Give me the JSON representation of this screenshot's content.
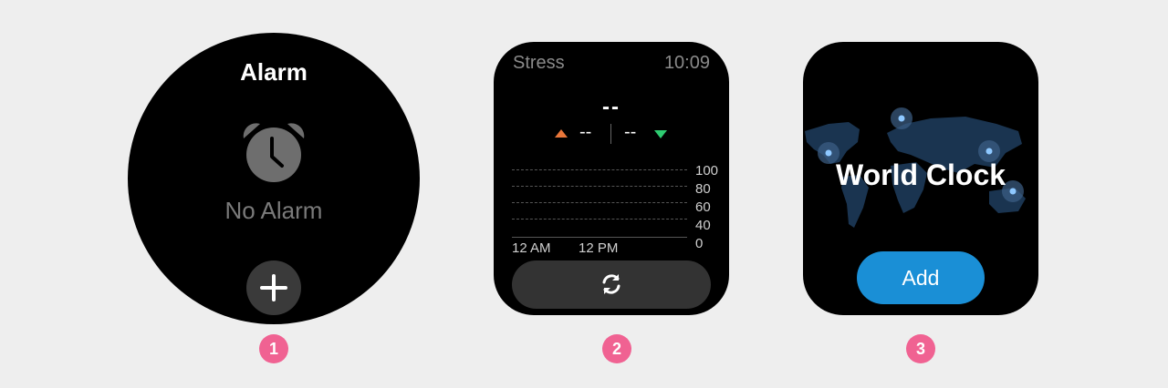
{
  "screens": [
    {
      "title": "Alarm",
      "icon": "alarm-clock-icon",
      "status": "No Alarm",
      "action_icon": "plus-icon"
    },
    {
      "title": "Stress",
      "time": "10:09",
      "value": "--",
      "low_value": "--",
      "high_value": "--",
      "low_indicator_color": "#e8763a",
      "high_indicator_color": "#2ecc71",
      "action_icon": "refresh-icon"
    },
    {
      "title": "World Clock",
      "background_icon": "world-map-icon",
      "button_label": "Add",
      "accent": "#1a8fd6"
    }
  ],
  "chart_data": {
    "type": "line",
    "yticks": [
      "100",
      "80",
      "60",
      "40",
      "0"
    ],
    "xticks": [
      "12 AM",
      "12 PM"
    ],
    "ylim": [
      0,
      100
    ],
    "series": [],
    "grid": true
  },
  "badges": [
    "1",
    "2",
    "3"
  ],
  "badge_color": "#f06292"
}
